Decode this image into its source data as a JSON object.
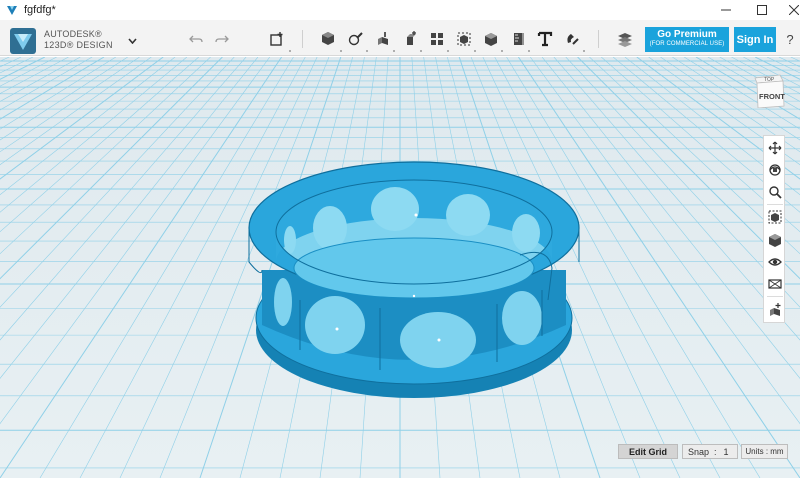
{
  "window": {
    "title": "fgfdfg*",
    "controls": [
      "minimize-icon",
      "maximize-icon",
      "close-icon"
    ]
  },
  "brand": {
    "line1": "AUTODESK®",
    "line2": "123D® DESIGN"
  },
  "toolbar": {
    "tools": [
      "undo-icon",
      "redo-icon",
      "new-primitive-icon",
      "primitives-icon",
      "sketch-icon",
      "construct-icon",
      "modify-icon",
      "pattern-icon",
      "group-icon",
      "combine-icon",
      "measure-icon",
      "text-icon",
      "snap-tool-icon",
      "material-icon"
    ],
    "premium_label": "Go Premium",
    "premium_sub": "(FOR COMMERCIAL USE)",
    "signin_label": "Sign In",
    "help_label": "?"
  },
  "viewcube": {
    "top_label": "TOP",
    "front_label": "FRONT"
  },
  "nav_tools": [
    "pan-icon",
    "orbit-icon",
    "zoom-icon",
    "fit-icon",
    "views-icon",
    "visibility-icon",
    "materials-icon",
    "snapshot-icon"
  ],
  "bottom": {
    "edit_grid_label": "Edit Grid",
    "snap_label": "Snap",
    "snap_separator": ":",
    "snap_value": "1",
    "units_label": "Units : mm"
  },
  "colors": {
    "accent": "#1aa3dc",
    "model": "#2dabe0",
    "model_dark": "#1582b4",
    "grid_line": "#8fd0e8",
    "viewport_bg": "#e4edf1"
  }
}
